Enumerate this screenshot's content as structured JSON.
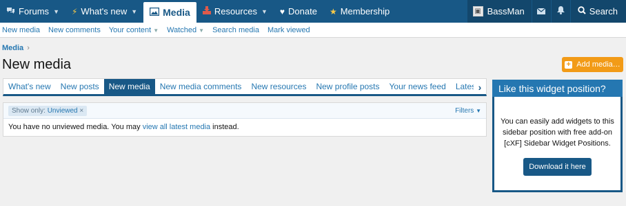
{
  "nav": {
    "tabs": [
      {
        "label": "Forums",
        "icon": "comments-icon",
        "dropdown": true
      },
      {
        "label": "What's new",
        "icon": "bolt-icon",
        "dropdown": true
      },
      {
        "label": "Media",
        "icon": "image-icon",
        "active": true
      },
      {
        "label": "Resources",
        "icon": "download-icon",
        "dropdown": true
      },
      {
        "label": "Donate",
        "icon": "heart-icon"
      },
      {
        "label": "Membership",
        "icon": "star-icon"
      }
    ],
    "user": "BassMan",
    "search": "Search"
  },
  "subnav": {
    "links": [
      "New media",
      "New comments",
      "Your content",
      "Watched",
      "Search media",
      "Mark viewed"
    ]
  },
  "breadcrumb": "Media",
  "page_title": "New media",
  "add_media": "Add media…",
  "tabs": [
    "What's new",
    "New posts",
    "New media",
    "New media comments",
    "New resources",
    "New profile posts",
    "Your news feed",
    "Latest ac"
  ],
  "filter": {
    "label": "Show only:",
    "value": "Unviewed",
    "remove": "×",
    "filters_btn": "Filters"
  },
  "message": {
    "before": "You have no unviewed media. You may ",
    "link": "view all latest media",
    "after": " instead."
  },
  "widget": {
    "title": "Like this widget position?",
    "body": "You can easily add widgets to this sidebar position with free add-on [cXF] Sidebar Widget Positions.",
    "button": "Download it here"
  },
  "colors": {
    "nav_bg": "#185886",
    "link": "#2577b1",
    "accent_orange": "#f29b17"
  }
}
